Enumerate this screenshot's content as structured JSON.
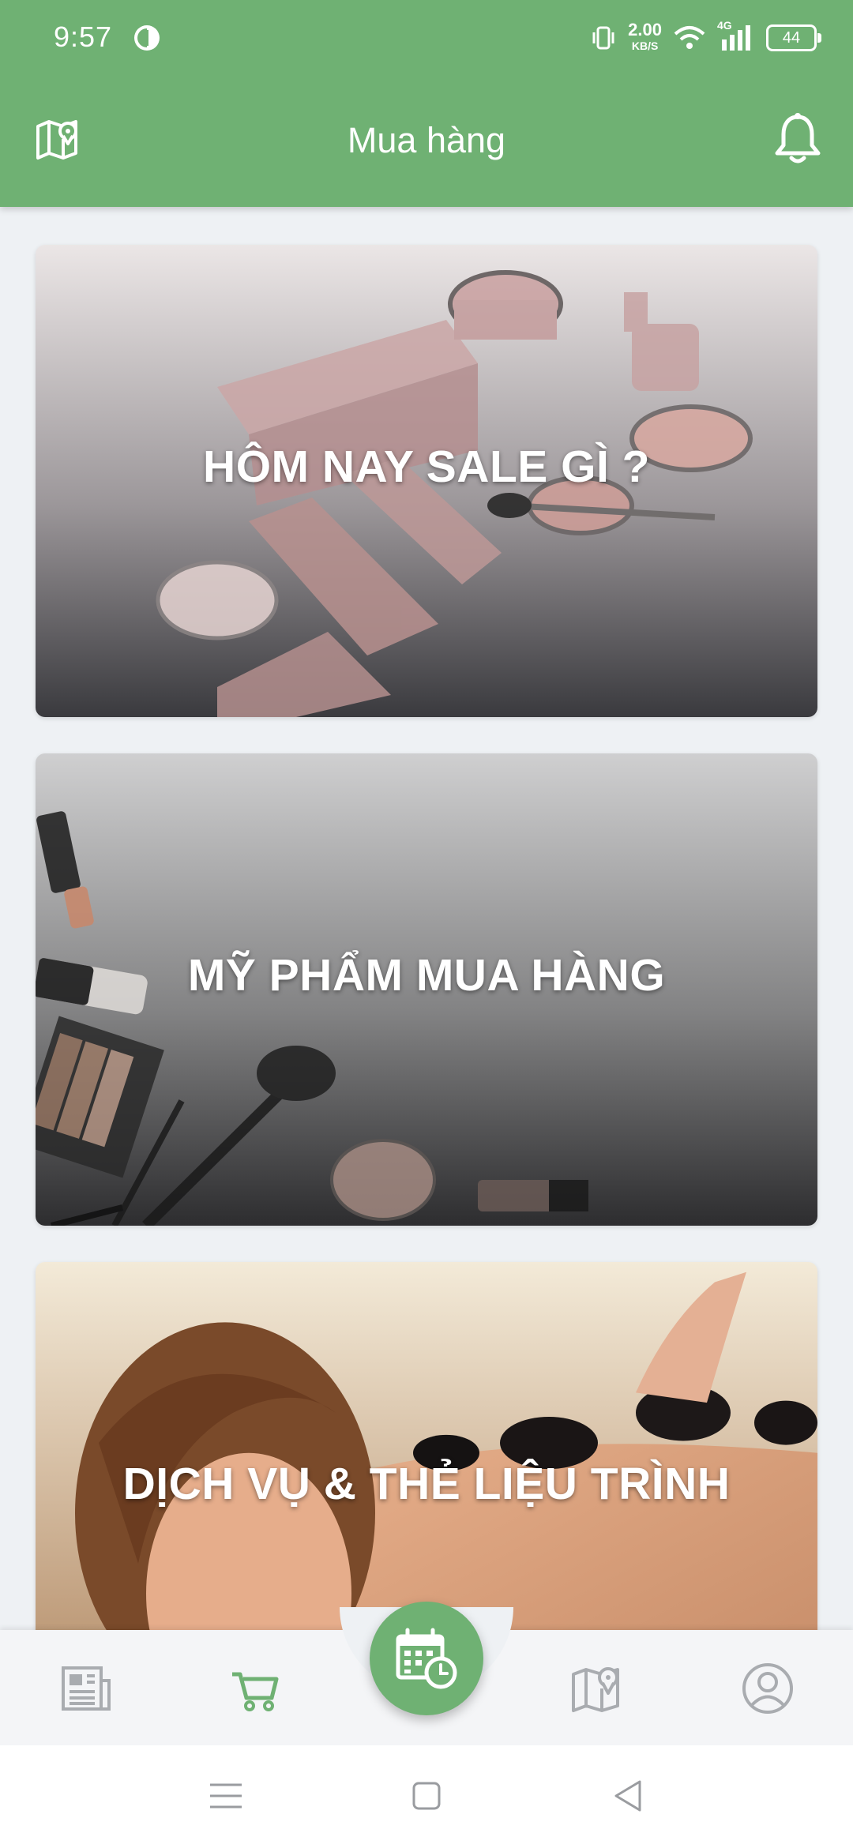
{
  "status_bar": {
    "time": "9:57",
    "net_speed_value": "2.00",
    "net_speed_unit": "KB/S",
    "network_type": "4G",
    "battery_level": "44"
  },
  "header": {
    "title": "Mua hàng",
    "left_icon": "map-pin-icon",
    "right_icon": "bell-icon"
  },
  "cards": [
    {
      "title": "HÔM NAY SALE GÌ ?"
    },
    {
      "title": "MỸ PHẨM MUA HÀNG"
    },
    {
      "title": "DỊCH VỤ & THẺ LIỆU TRÌNH"
    }
  ],
  "bottom_nav": {
    "items": [
      {
        "icon": "newspaper-icon",
        "active": false
      },
      {
        "icon": "cart-icon",
        "active": true
      },
      {
        "icon": "calendar-clock-icon",
        "active": false
      },
      {
        "icon": "map-icon",
        "active": false
      },
      {
        "icon": "user-icon",
        "active": false
      }
    ]
  },
  "colors": {
    "brand_green": "#6fb173",
    "inactive_icon": "#a9acb0",
    "background": "#eef1f4"
  }
}
